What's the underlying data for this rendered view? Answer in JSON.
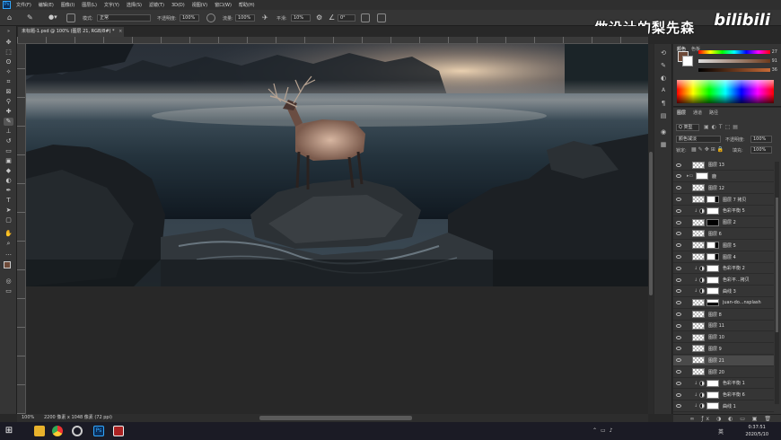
{
  "menubar": {
    "app_icon": "Ps",
    "items": [
      "文件(F)",
      "编辑(E)",
      "图像(I)",
      "图层(L)",
      "文字(Y)",
      "选择(S)",
      "滤镜(T)",
      "3D(D)",
      "视图(V)",
      "窗口(W)",
      "帮助(H)"
    ]
  },
  "options": {
    "mode_label": "模式:",
    "mode_value": "正常",
    "opacity_label": "不透明度:",
    "opacity_value": "100%",
    "flow_label": "流量:",
    "flow_value": "100%",
    "smooth_label": "平滑:",
    "smooth_value": "10%",
    "angle_value": "0°"
  },
  "watermark": {
    "channel": "做设计的梨先森",
    "logo": "bilibili"
  },
  "document": {
    "tab_title": "未标题-1.psd @ 100% (图层 21, RGB/8#) *"
  },
  "status": {
    "zoom": "100%",
    "doc_info": "2200 像素 x 1048 像素 (72 ppi)"
  },
  "color_panel": {
    "tabs": [
      "颜色",
      "色板"
    ],
    "slider_values": [
      "27",
      "91",
      "36"
    ],
    "fg_color": "#6e4a38",
    "bg_color": "#ffffff"
  },
  "layers_panel": {
    "tabs": [
      "图层",
      "通道",
      "路径"
    ],
    "kind_filter": "Q 类型",
    "blend_mode": "颜色减淡",
    "opacity_label": "不透明度:",
    "opacity_value": "100%",
    "lock_label": "锁定:",
    "fill_label": "填充:",
    "fill_value": "100%",
    "layers": [
      {
        "name": "图层 13",
        "kind": "pixel",
        "selected": false
      },
      {
        "name": "鹿",
        "kind": "group",
        "selected": false
      },
      {
        "name": "图层 12",
        "kind": "pixel",
        "selected": false
      },
      {
        "name": "图层 7 拷贝",
        "kind": "pixel-mask",
        "selected": false
      },
      {
        "name": "色彩平衡 5",
        "kind": "adjust",
        "selected": false
      },
      {
        "name": "图层 2",
        "kind": "pixel-mask-dark",
        "selected": false
      },
      {
        "name": "图层 6",
        "kind": "pixel",
        "selected": false
      },
      {
        "name": "图层 5",
        "kind": "pixel-mask",
        "selected": false
      },
      {
        "name": "图层 4",
        "kind": "pixel-mask",
        "selected": false
      },
      {
        "name": "色彩平衡 2",
        "kind": "adjust",
        "selected": false
      },
      {
        "name": "色彩平...拷贝",
        "kind": "adjust",
        "selected": false
      },
      {
        "name": "曲线 3",
        "kind": "adjust",
        "selected": false
      },
      {
        "name": "juan-do...nsplash",
        "kind": "photo",
        "selected": false
      },
      {
        "name": "图层 8",
        "kind": "pixel",
        "selected": false
      },
      {
        "name": "图层 11",
        "kind": "pixel",
        "selected": false
      },
      {
        "name": "图层 10",
        "kind": "pixel",
        "selected": false
      },
      {
        "name": "图层 9",
        "kind": "pixel",
        "selected": false
      },
      {
        "name": "图层 21",
        "kind": "pixel",
        "selected": true
      },
      {
        "name": "图层 20",
        "kind": "pixel",
        "selected": false
      },
      {
        "name": "色彩平衡 1",
        "kind": "adjust",
        "selected": false
      },
      {
        "name": "色彩平衡 6",
        "kind": "adjust",
        "selected": false
      },
      {
        "name": "曲线 1",
        "kind": "adjust",
        "selected": false
      }
    ]
  },
  "taskbar": {
    "ime": "英",
    "time": "0:37:51",
    "date": "2020/5/10"
  }
}
